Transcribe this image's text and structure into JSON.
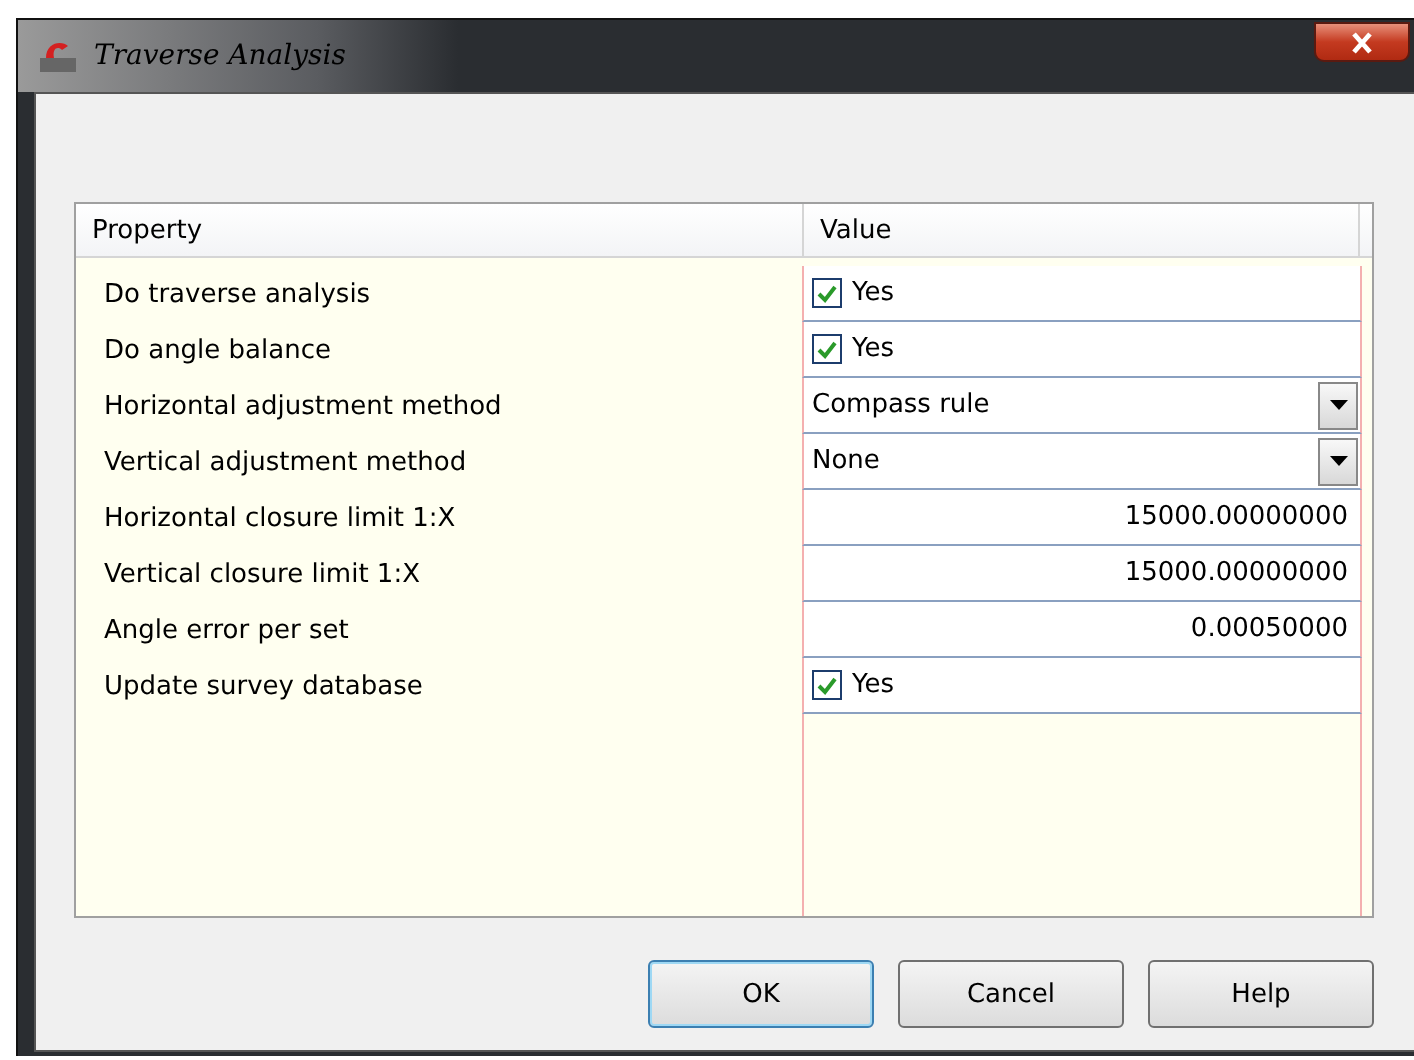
{
  "window": {
    "title": "Traverse Analysis"
  },
  "table": {
    "columns": [
      "Property",
      "Value"
    ],
    "rows": [
      {
        "property": "Do traverse analysis",
        "kind": "checkbox",
        "checked": true,
        "value": "Yes"
      },
      {
        "property": "Do angle balance",
        "kind": "checkbox",
        "checked": true,
        "value": "Yes"
      },
      {
        "property": "Horizontal adjustment method",
        "kind": "dropdown",
        "value": "Compass rule"
      },
      {
        "property": "Vertical adjustment method",
        "kind": "dropdown",
        "value": "None"
      },
      {
        "property": "Horizontal closure limit 1:X",
        "kind": "number",
        "value": "15000.00000000"
      },
      {
        "property": "Vertical closure limit 1:X",
        "kind": "number",
        "value": "15000.00000000"
      },
      {
        "property": "Angle error per set",
        "kind": "number",
        "value": "0.00050000"
      },
      {
        "property": "Update survey database",
        "kind": "checkbox",
        "checked": true,
        "value": "Yes"
      }
    ]
  },
  "buttons": [
    {
      "label": "OK",
      "selected": true
    },
    {
      "label": "Cancel",
      "selected": false
    },
    {
      "label": "Help",
      "selected": false
    }
  ]
}
